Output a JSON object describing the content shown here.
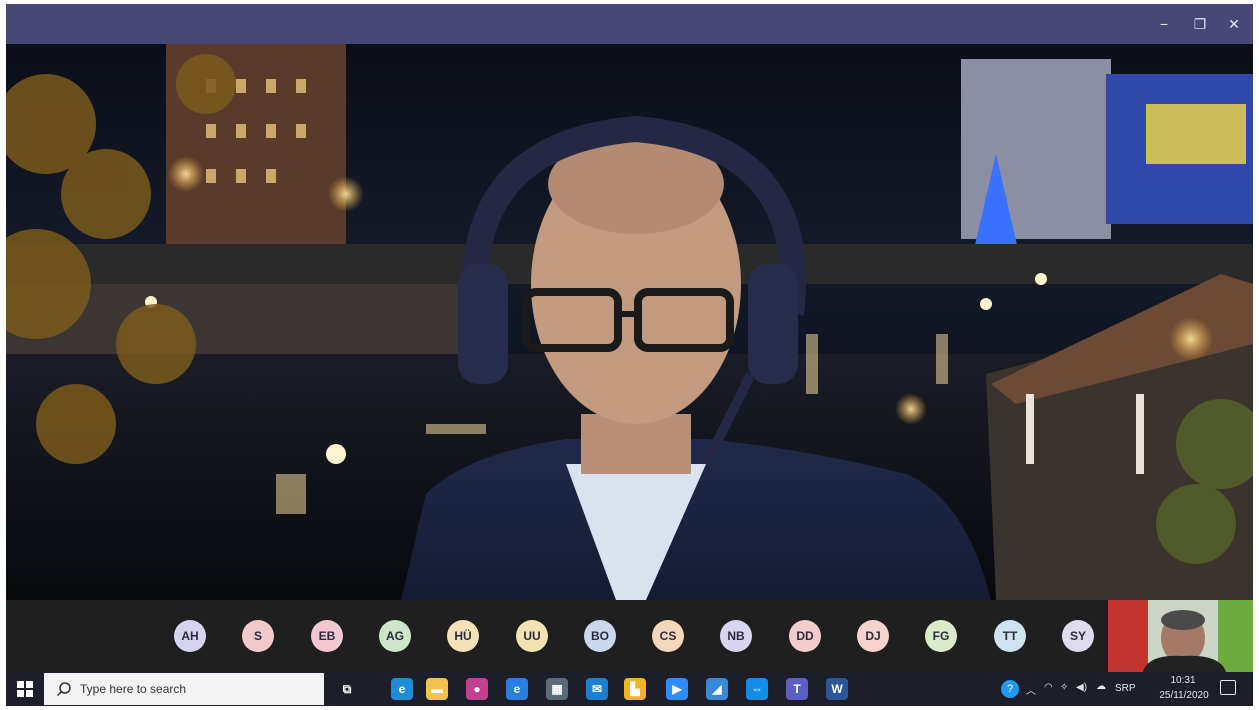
{
  "window": {
    "minimize_glyph": "−",
    "maximize_glyph": "❐",
    "close_glyph": "✕"
  },
  "participants": [
    {
      "initials": "AH",
      "color": "#d6d3f0"
    },
    {
      "initials": "S",
      "color": "#f1c9c9"
    },
    {
      "initials": "EB",
      "color": "#f2c7d0"
    },
    {
      "initials": "AG",
      "color": "#cde6c9"
    },
    {
      "initials": "HÜ",
      "color": "#f4e1b5"
    },
    {
      "initials": "UU",
      "color": "#f3e3b2"
    },
    {
      "initials": "BO",
      "color": "#c9d7ef"
    },
    {
      "initials": "CS",
      "color": "#f4d6ba"
    },
    {
      "initials": "NB",
      "color": "#d9d4f2"
    },
    {
      "initials": "DD",
      "color": "#f3cccc"
    },
    {
      "initials": "DJ",
      "color": "#f5d2cc"
    },
    {
      "initials": "FG",
      "color": "#d9ebc9"
    },
    {
      "initials": "TT",
      "color": "#cfe3ef"
    },
    {
      "initials": "SY",
      "color": "#e0dcef"
    }
  ],
  "taskbar": {
    "search_placeholder": "Type here to search",
    "apps": [
      {
        "icon": "task-view-icon",
        "color": "#1c1e2a",
        "glyph": "⧉"
      },
      {
        "icon": "edge-icon",
        "color": "#1f8dd6",
        "glyph": "e"
      },
      {
        "icon": "file-explorer-icon",
        "color": "#f2c14e",
        "glyph": "▬"
      },
      {
        "icon": "paint-icon",
        "color": "#c63f8e",
        "glyph": "●"
      },
      {
        "icon": "internet-explorer-icon",
        "color": "#2a7de1",
        "glyph": "e"
      },
      {
        "icon": "calculator-icon",
        "color": "#5a6b7a",
        "glyph": "▦"
      },
      {
        "icon": "mail-icon",
        "color": "#1d7fd0",
        "glyph": "✉"
      },
      {
        "icon": "word-pad-icon",
        "color": "#f0b429",
        "glyph": "▙"
      },
      {
        "icon": "zoom-icon",
        "color": "#2d8cff",
        "glyph": "▶"
      },
      {
        "icon": "app-icon",
        "color": "#3a88d8",
        "glyph": "◢"
      },
      {
        "icon": "teamviewer-icon",
        "color": "#0e8ee9",
        "glyph": "⇔"
      },
      {
        "icon": "teams-icon",
        "color": "#5b5fc7",
        "glyph": "T"
      },
      {
        "icon": "word-icon",
        "color": "#2b579a",
        "glyph": "W"
      }
    ],
    "language": "SRP",
    "time": "10:31",
    "date": "25/11/2020"
  }
}
